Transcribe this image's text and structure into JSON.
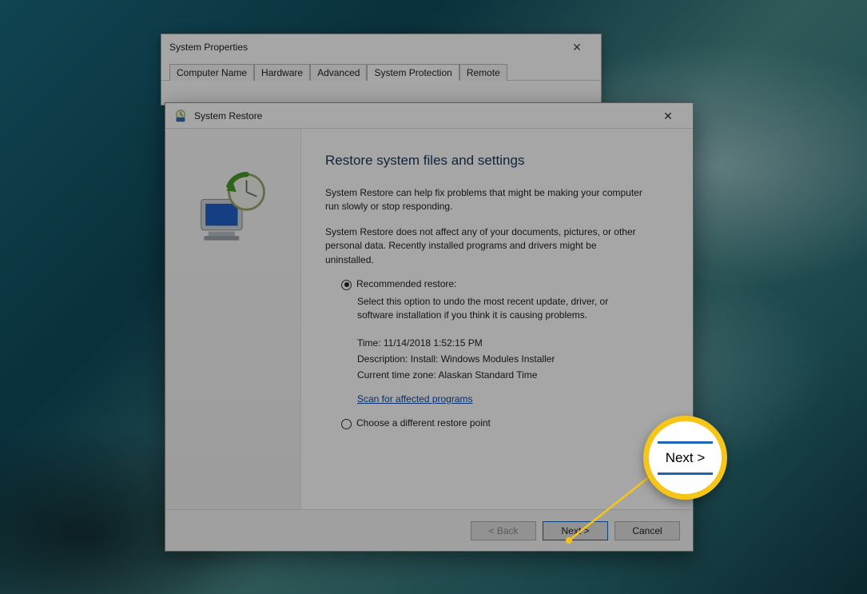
{
  "sysprops": {
    "title": "System Properties",
    "tabs": {
      "computer_name": "Computer Name",
      "hardware": "Hardware",
      "advanced": "Advanced",
      "system_protection": "System Protection",
      "remote": "Remote"
    }
  },
  "restore": {
    "title": "System Restore",
    "heading": "Restore system files and settings",
    "intro1": "System Restore can help fix problems that might be making your computer run slowly or stop responding.",
    "intro2": "System Restore does not affect any of your documents, pictures, or other personal data. Recently installed programs and drivers might be uninstalled.",
    "opt_recommended_label": "Recommended restore:",
    "opt_recommended_desc": "Select this option to undo the most recent update, driver, or software installation if you think it is causing problems.",
    "meta_time": "Time: 11/14/2018 1:52:15 PM",
    "meta_desc": "Description: Install: Windows Modules Installer",
    "meta_tz": "Current time zone: Alaskan Standard Time",
    "scan_link": "Scan for affected programs",
    "opt_different_label": "Choose a different restore point",
    "buttons": {
      "back": "< Back",
      "next": "Next >",
      "cancel": "Cancel"
    }
  },
  "callout": {
    "label": "Next >"
  }
}
